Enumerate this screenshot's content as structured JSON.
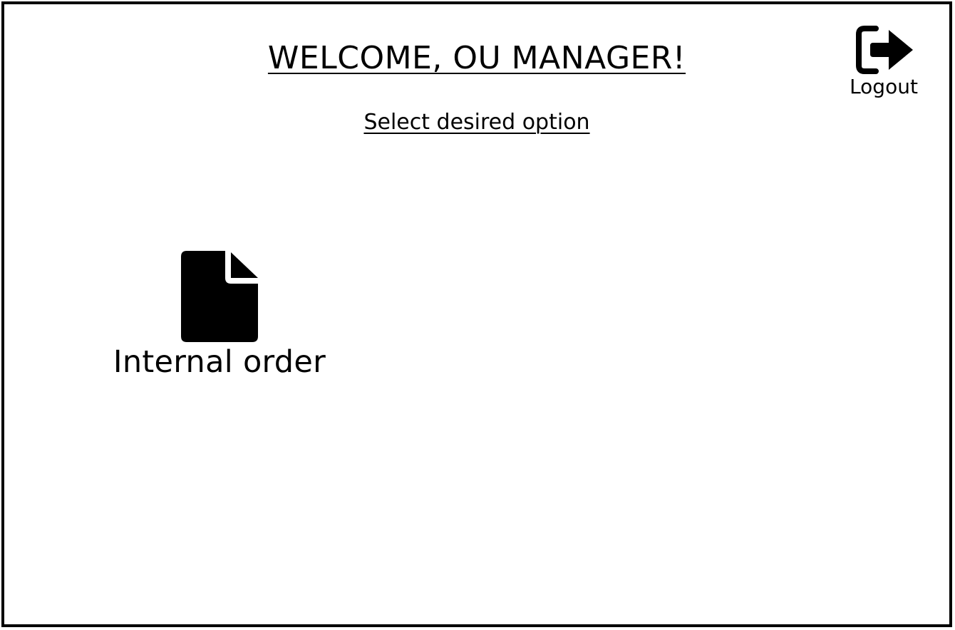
{
  "header": {
    "title": "WELCOME, OU MANAGER!",
    "subtitle": "Select desired option"
  },
  "logout": {
    "icon": "logout-icon",
    "label": "Logout"
  },
  "options": [
    {
      "icon": "document-icon",
      "label": "Internal order"
    }
  ],
  "colors": {
    "foreground": "#000000",
    "background": "#ffffff"
  }
}
